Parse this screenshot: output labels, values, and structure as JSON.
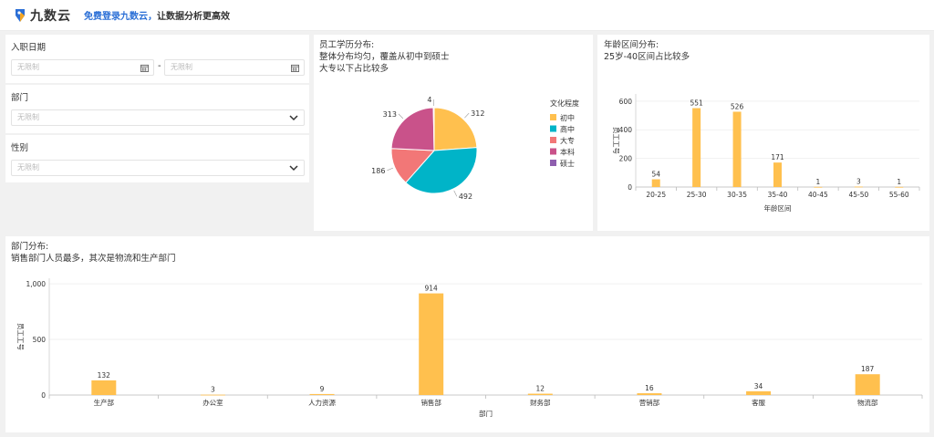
{
  "header": {
    "logo_text": "九数云",
    "slogan_highlight": "免费登录九数云，",
    "slogan_rest": "让数据分析更高效"
  },
  "filters": {
    "hire_date": {
      "label": "入职日期",
      "start_placeholder": "无限制",
      "end_placeholder": "无限制",
      "separator": "-"
    },
    "department": {
      "label": "部门",
      "placeholder": "无限制"
    },
    "gender": {
      "label": "性别",
      "placeholder": "无限制"
    }
  },
  "education_card": {
    "title_lines": [
      "员工学历分布:",
      "整体分布均匀，覆盖从初中到硕士",
      "大专以下占比较多"
    ],
    "chart_data": {
      "type": "pie",
      "legend_title": "文化程度",
      "legend_position": "right",
      "slices": [
        {
          "name": "初中",
          "value": 312,
          "color": "#FFC04E"
        },
        {
          "name": "高中",
          "value": 492,
          "color": "#00B4C8"
        },
        {
          "name": "大专",
          "value": 186,
          "color": "#F27777"
        },
        {
          "name": "本科",
          "value": 313,
          "color": "#C9528A"
        },
        {
          "name": "硕士",
          "value": 4,
          "color": "#8E5EAE"
        }
      ]
    }
  },
  "age_card": {
    "title_lines": [
      "年龄区间分布:",
      "25岁-40区间占比较多"
    ],
    "chart_data": {
      "type": "bar",
      "categories": [
        "20-25",
        "25-30",
        "30-35",
        "35-40",
        "40-45",
        "45-50",
        "55-60"
      ],
      "values": [
        54,
        551,
        526,
        171,
        1,
        3,
        1
      ],
      "xlabel": "年龄区间",
      "ylabel": "员工工号",
      "ylim": [
        0,
        650
      ],
      "yticks": [
        0,
        200,
        400,
        600
      ],
      "grid": true,
      "color": "#FFC04E"
    }
  },
  "dept_card": {
    "title_lines": [
      "部门分布:",
      "销售部门人员最多，其次是物流和生产部门"
    ],
    "chart_data": {
      "type": "bar",
      "categories": [
        "生产部",
        "办公室",
        "人力资源",
        "销售部",
        "财务部",
        "营销部",
        "客服",
        "物流部"
      ],
      "values": [
        132,
        3,
        9,
        914,
        12,
        16,
        34,
        187
      ],
      "xlabel": "部门",
      "ylabel": "员工工号",
      "ylim": [
        0,
        1050
      ],
      "yticks": [
        0,
        500,
        1000
      ],
      "ytick_labels": [
        "0",
        "500",
        "1,000"
      ],
      "grid": true,
      "color": "#FFC04E"
    }
  }
}
